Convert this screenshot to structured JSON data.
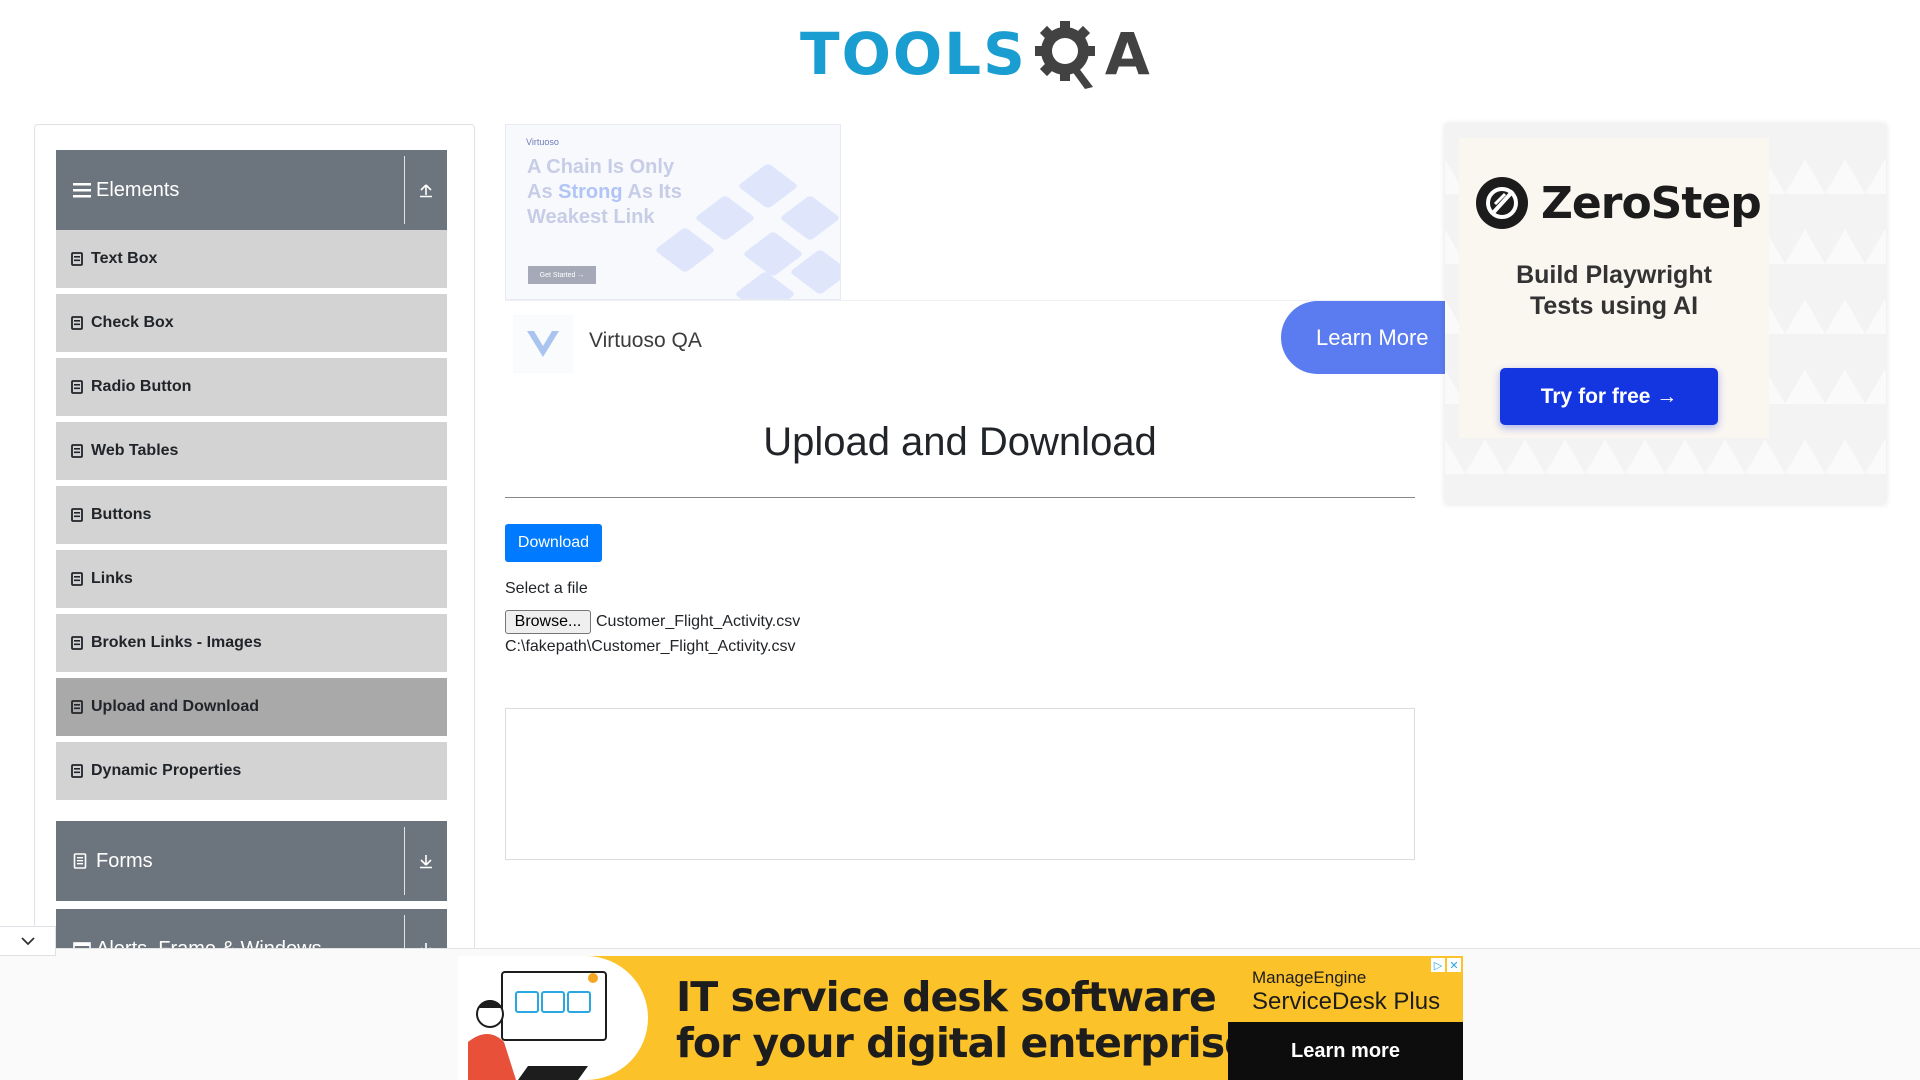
{
  "header": {
    "logo_text_tools": "TOOLS",
    "logo_text_a": "A"
  },
  "sidebar": {
    "groups": [
      {
        "label": "Elements",
        "expanded": true
      },
      {
        "label": "Forms",
        "expanded": false
      },
      {
        "label": "Alerts, Frame & Windows",
        "expanded": false
      }
    ],
    "items": [
      {
        "label": "Text Box"
      },
      {
        "label": "Check Box"
      },
      {
        "label": "Radio Button"
      },
      {
        "label": "Web Tables"
      },
      {
        "label": "Buttons"
      },
      {
        "label": "Links"
      },
      {
        "label": "Broken Links - Images"
      },
      {
        "label": "Upload and Download",
        "active": true
      },
      {
        "label": "Dynamic Properties"
      }
    ]
  },
  "ad_top": {
    "brand": "Virtuoso",
    "headline_1": "A Chain Is Only",
    "headline_2a": "As ",
    "headline_2b": "Strong",
    "headline_2c": " As Its",
    "headline_3": "Weakest Link",
    "small_button": "Get Started →",
    "advertiser": "Virtuoso QA",
    "cta": "Learn More"
  },
  "main": {
    "title": "Upload and Download",
    "download_label": "Download",
    "select_label": "Select a file",
    "browse_label": "Browse...",
    "selected_file": "Customer_Flight_Activity.csv",
    "uploaded_path": "C:\\fakepath\\Customer_Flight_Activity.csv"
  },
  "ad_right": {
    "brand": "ZeroStep",
    "tagline_1": "Build Playwright",
    "tagline_2": "Tests using AI",
    "cta": "Try for free →"
  },
  "ad_bottom": {
    "headline_1": "IT service desk software",
    "headline_2": "for your digital enterprise",
    "brand": "ManageEngine",
    "product": "ServiceDesk Plus",
    "cta": "Learn more"
  },
  "colors": {
    "accent": "#007bff",
    "sidebar_header": "#6c757d",
    "sidebar_item": "#d3d3d3",
    "sidebar_item_active": "#a9a9a9",
    "logo_blue": "#1a9ed1",
    "bottom_ad_bg": "#fcc22a"
  }
}
